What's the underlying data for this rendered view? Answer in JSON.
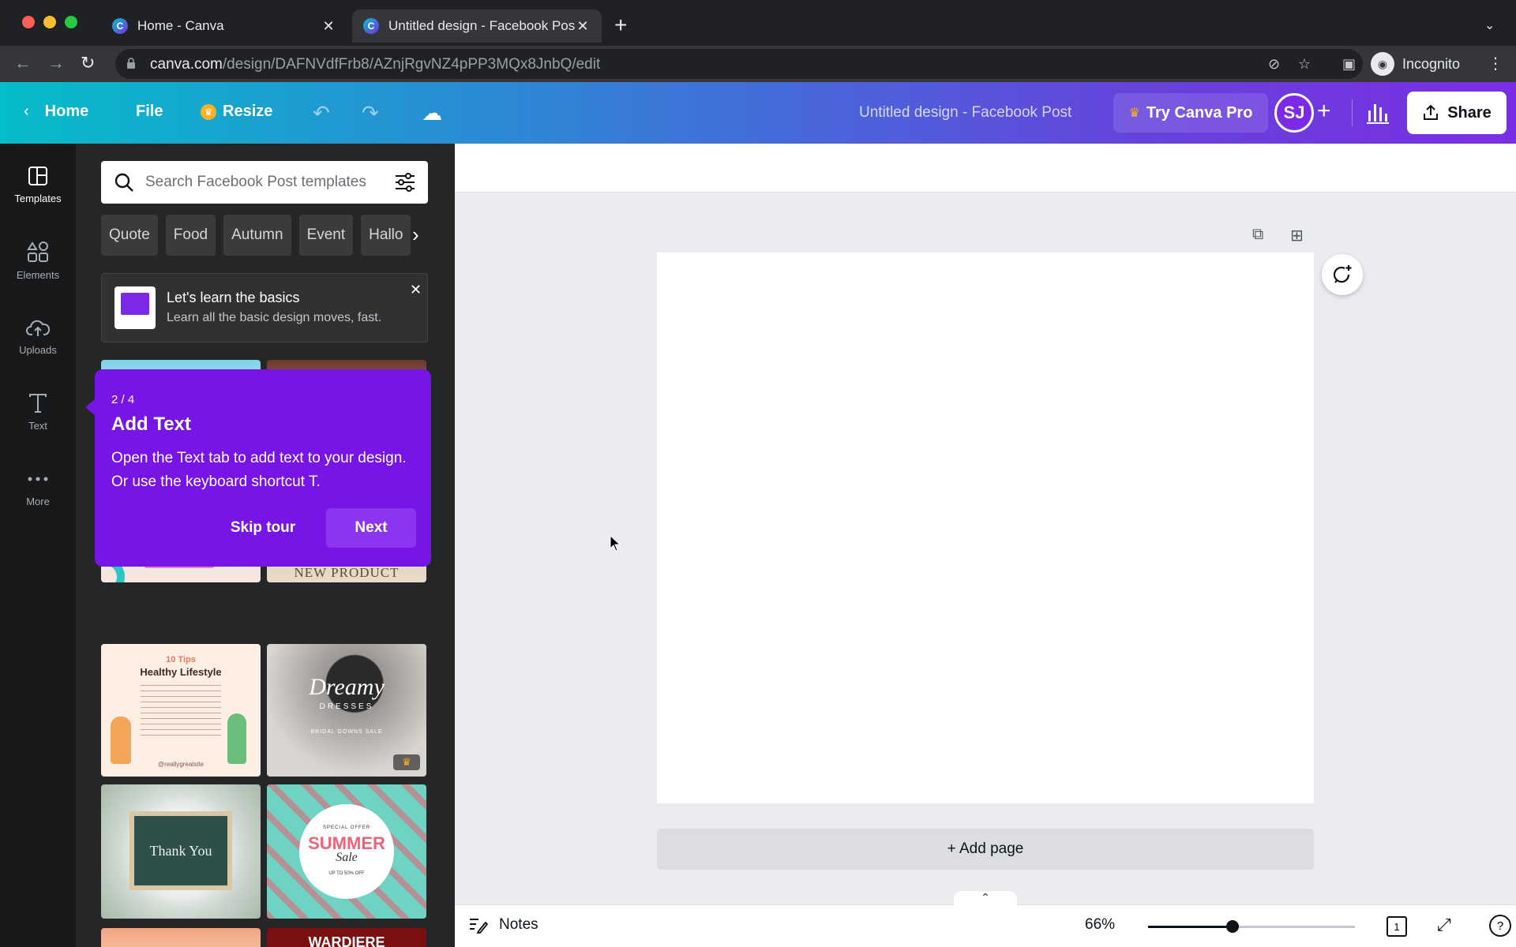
{
  "browser": {
    "tabs": [
      {
        "title": "Home - Canva",
        "active": false
      },
      {
        "title": "Untitled design - Facebook Pos",
        "active": true
      }
    ],
    "url_domain": "canva.com",
    "url_path": "/design/DAFNVdfFrb8/AZnjRgvNZ4pPP3MQx8JnbQ/edit",
    "profile_label": "Incognito"
  },
  "topbar": {
    "home_label": "Home",
    "file_label": "File",
    "resize_label": "Resize",
    "design_title": "Untitled design - Facebook Post",
    "pro_label": "Try Canva Pro",
    "avatar_initials": "SJ",
    "share_label": "Share"
  },
  "rail": {
    "items": [
      {
        "label": "Templates",
        "icon": "templates-icon"
      },
      {
        "label": "Elements",
        "icon": "elements-icon"
      },
      {
        "label": "Uploads",
        "icon": "uploads-icon"
      },
      {
        "label": "Text",
        "icon": "text-icon"
      },
      {
        "label": "More",
        "icon": "more-icon"
      }
    ]
  },
  "panel": {
    "search_placeholder": "Search Facebook Post templates",
    "chips": [
      "Quote",
      "Food",
      "Autumn",
      "Event",
      "Hallo"
    ],
    "learn_title": "Let's learn the basics",
    "learn_subtitle": "Learn all the basic design moves, fast.",
    "templates": {
      "new_product": "NEW PRODUCT",
      "healthy_small": "10 Tips",
      "healthy_title": "Healthy Lifestyle",
      "healthy_handle": "@reallygreatsite",
      "dreamy_title": "Dreamy",
      "dreamy_sub": "DRESSES",
      "dreamy_small": "BRIDAL GOWNS SALE",
      "thank_you": "Thank You",
      "summer_small": "SPECIAL OFFER",
      "summer_title": "SUMMER",
      "summer_script": "Sale",
      "summer_off": "UP TO 50% OFF",
      "wardiere": "WARDIERE"
    }
  },
  "tour": {
    "step": "2 / 4",
    "title": "Add Text",
    "body": "Open the Text tab to add text to your design. Or use the keyboard shortcut T.",
    "skip_label": "Skip tour",
    "next_label": "Next"
  },
  "editor": {
    "add_page_label": "+ Add page"
  },
  "bottombar": {
    "notes_label": "Notes",
    "zoom_label": "66%",
    "zoom_value": 66,
    "page_count": "1"
  },
  "colors": {
    "tour_purple": "#7615e6",
    "gradient_start": "#05bcc9",
    "gradient_end": "#7a2ee3"
  }
}
